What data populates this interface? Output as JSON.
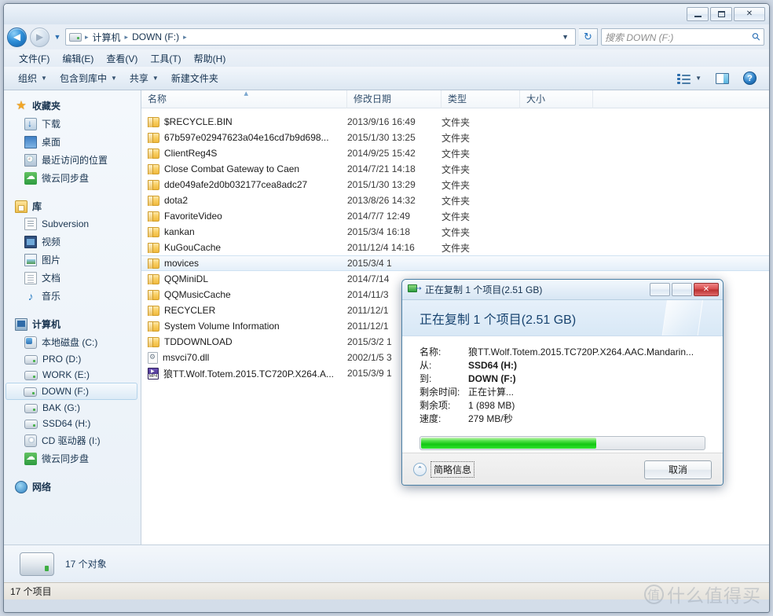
{
  "window": {
    "minimize_label": "最小化",
    "maximize_label": "最大化",
    "close_label": "✕"
  },
  "address": {
    "back_glyph": "◄",
    "forward_glyph": "►",
    "dropdown_glyph": "▼",
    "crumbs": [
      "计算机",
      "DOWN (F:)"
    ],
    "separator": "▸",
    "refresh_glyph": "↻"
  },
  "search": {
    "placeholder": "搜索 DOWN (F:)",
    "icon": "search-icon"
  },
  "menubar": {
    "items": [
      "文件(F)",
      "编辑(E)",
      "查看(V)",
      "工具(T)",
      "帮助(H)"
    ]
  },
  "toolbar": {
    "organize": "组织",
    "include_in_library": "包含到库中",
    "share": "共享",
    "new_folder": "新建文件夹",
    "caret": "▼"
  },
  "sidebar": {
    "groups": [
      {
        "head": {
          "label": "收藏夹",
          "icon": "star-icon"
        },
        "items": [
          {
            "label": "下载",
            "icon": "download-icon"
          },
          {
            "label": "桌面",
            "icon": "desktop-icon"
          },
          {
            "label": "最近访问的位置",
            "icon": "recent-places-icon"
          },
          {
            "label": "微云同步盘",
            "icon": "weiyun-cloud-icon"
          }
        ]
      },
      {
        "head": {
          "label": "库",
          "icon": "library-icon"
        },
        "items": [
          {
            "label": "Subversion",
            "icon": "subversion-icon"
          },
          {
            "label": "视频",
            "icon": "video-icon"
          },
          {
            "label": "图片",
            "icon": "pictures-icon"
          },
          {
            "label": "文档",
            "icon": "documents-icon"
          },
          {
            "label": "音乐",
            "icon": "music-icon"
          }
        ]
      },
      {
        "head": {
          "label": "计算机",
          "icon": "computer-icon"
        },
        "items": [
          {
            "label": "本地磁盘 (C:)",
            "icon": "system-disk-icon"
          },
          {
            "label": "PRO (D:)",
            "icon": "hdd-icon"
          },
          {
            "label": "WORK (E:)",
            "icon": "hdd-icon"
          },
          {
            "label": "DOWN (F:)",
            "icon": "hdd-icon",
            "selected": true
          },
          {
            "label": "BAK (G:)",
            "icon": "hdd-icon"
          },
          {
            "label": "SSD64 (H:)",
            "icon": "hdd-icon"
          },
          {
            "label": "CD 驱动器 (I:)",
            "icon": "cd-drive-icon"
          },
          {
            "label": "微云同步盘",
            "icon": "weiyun-cloud-icon"
          }
        ]
      },
      {
        "head": {
          "label": "网络",
          "icon": "network-icon"
        },
        "items": []
      }
    ]
  },
  "filelist": {
    "columns": [
      "名称",
      "修改日期",
      "类型",
      "大小"
    ],
    "sorted_column": 0,
    "rows": [
      {
        "name": "$RECYCLE.BIN",
        "date": "2013/9/16 16:49",
        "type": "文件夹",
        "size": "",
        "icon": "folder-icon"
      },
      {
        "name": "67b597e02947623a04e16cd7b9d698...",
        "date": "2015/1/30 13:25",
        "type": "文件夹",
        "size": "",
        "icon": "folder-icon"
      },
      {
        "name": "ClientReg4S",
        "date": "2014/9/25 15:42",
        "type": "文件夹",
        "size": "",
        "icon": "folder-icon"
      },
      {
        "name": "Close Combat Gateway to Caen",
        "date": "2014/7/21 14:18",
        "type": "文件夹",
        "size": "",
        "icon": "folder-icon"
      },
      {
        "name": "dde049afe2d0b032177cea8adc27",
        "date": "2015/1/30 13:29",
        "type": "文件夹",
        "size": "",
        "icon": "folder-icon"
      },
      {
        "name": "dota2",
        "date": "2013/8/26 14:32",
        "type": "文件夹",
        "size": "",
        "icon": "folder-icon"
      },
      {
        "name": "FavoriteVideo",
        "date": "2014/7/7 12:49",
        "type": "文件夹",
        "size": "",
        "icon": "folder-icon"
      },
      {
        "name": "kankan",
        "date": "2015/3/4 16:18",
        "type": "文件夹",
        "size": "",
        "icon": "folder-icon"
      },
      {
        "name": "KuGouCache",
        "date": "2011/12/4 14:16",
        "type": "文件夹",
        "size": "",
        "icon": "folder-icon"
      },
      {
        "name": "movices",
        "date": "2015/3/4 1",
        "type": "",
        "size": "",
        "icon": "folder-icon",
        "selected": true
      },
      {
        "name": "QQMiniDL",
        "date": "2014/7/14",
        "type": "",
        "size": "",
        "icon": "folder-icon"
      },
      {
        "name": "QQMusicCache",
        "date": "2014/11/3",
        "type": "",
        "size": "",
        "icon": "folder-icon"
      },
      {
        "name": "RECYCLER",
        "date": "2011/12/1",
        "type": "",
        "size": "",
        "icon": "folder-icon"
      },
      {
        "name": "System Volume Information",
        "date": "2011/12/1",
        "type": "",
        "size": "",
        "icon": "folder-icon"
      },
      {
        "name": "TDDOWNLOAD",
        "date": "2015/3/2 1",
        "type": "",
        "size": "",
        "icon": "folder-icon"
      },
      {
        "name": "msvci70.dll",
        "date": "2002/1/5 3",
        "type": "",
        "size": "",
        "icon": "dll-file-icon"
      },
      {
        "name": "狼TT.Wolf.Totem.2015.TC720P.X264.A...",
        "date": "2015/3/9 1",
        "type": "",
        "size": "",
        "icon": "mp4-file-icon"
      }
    ]
  },
  "details_pane": {
    "object_count": "17 个对象",
    "icon": "hard-drive-icon"
  },
  "statusbar": {
    "text": "17 个项目"
  },
  "copy_dialog": {
    "titlebar_text": "正在复制 1 个项目(2.51 GB)",
    "banner_heading": "正在复制 1 个项目(2.51 GB)",
    "minimize_label": "最小化",
    "maximize_label": "最大化",
    "close_label": "✕",
    "fields": [
      {
        "label": "名称:",
        "value": "狼TT.Wolf.Totem.2015.TC720P.X264.AAC.Mandarin...",
        "bold": false
      },
      {
        "label": "从:",
        "value": "SSD64 (H:)",
        "bold": true
      },
      {
        "label": "到:",
        "value": "DOWN (F:)",
        "bold": true
      },
      {
        "label": "剩余时间:",
        "value": "正在计算...",
        "bold": false
      },
      {
        "label": "剩余项:",
        "value": "1 (898 MB)",
        "bold": false
      },
      {
        "label": "速度:",
        "value": "279 MB/秒",
        "bold": false
      }
    ],
    "progress_percent": 62,
    "progress_color": "#13c613",
    "less_info_label": "简略信息",
    "less_info_chevron": "⌃",
    "cancel_label": "取消"
  },
  "watermark": {
    "badge": "值",
    "text": "什么值得买"
  },
  "chart_data": null
}
